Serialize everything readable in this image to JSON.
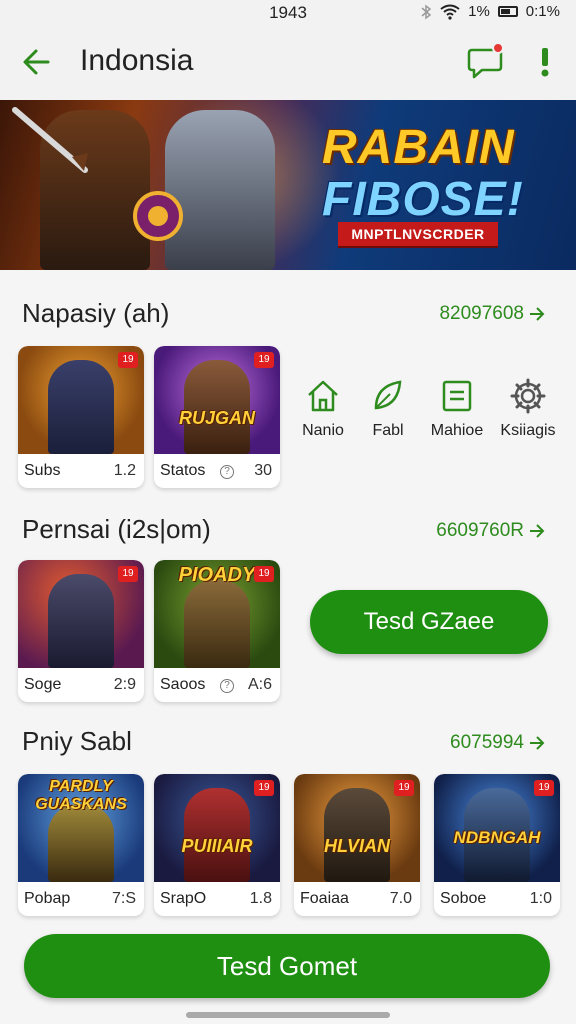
{
  "status_bar": {
    "time": "1943",
    "signal_text": "1%",
    "battery_text": "0:1%"
  },
  "app_bar": {
    "title": "Indonsia",
    "back_icon": "back-arrow-icon",
    "notification_icon": "chat-bubble-icon",
    "alert_icon": "exclamation-icon"
  },
  "banner": {
    "line1": "RABAIN",
    "line2": "FIBOSE!",
    "ribbon": "MNPTLNVSCRDER"
  },
  "sections": [
    {
      "title": "Napasiy (ah)",
      "more": "82097608",
      "cards": [
        {
          "name": "Subs",
          "rating": "1.2",
          "badge": "19",
          "art_word": ""
        },
        {
          "name": "Statos",
          "rating": "30",
          "badge": "19",
          "art_word": "RUJGAN",
          "info": "?"
        }
      ],
      "quick_actions": [
        {
          "label": "Nanio",
          "icon": "home-icon"
        },
        {
          "label": "Fabl",
          "icon": "leaf-icon"
        },
        {
          "label": "Mahioe",
          "icon": "list-icon"
        },
        {
          "label": "Ksiiagis",
          "icon": "gear-icon"
        }
      ]
    },
    {
      "title": "Pernsai (i2s|om)",
      "more": "6609760R",
      "cards": [
        {
          "name": "Soge",
          "rating": "2:9",
          "badge": "19",
          "art_word": ""
        },
        {
          "name": "Saoos",
          "rating": "A:6",
          "badge": "19",
          "art_word": "PIOADY",
          "info": "?"
        }
      ],
      "button": "Tesd GZaee"
    },
    {
      "title": "Pniy Sabl",
      "more": "6075994",
      "cards": [
        {
          "name": "Pobap",
          "rating": "7:S",
          "badge": "",
          "art_word": "PARDLY GUASKANS"
        },
        {
          "name": "SrapO",
          "rating": "1.8",
          "badge": "19",
          "art_word": "PUIIIAIR"
        },
        {
          "name": "Foaiaa",
          "rating": "7.0",
          "badge": "19",
          "art_word": "HLVIAN"
        },
        {
          "name": "Soboe",
          "rating": "1:0",
          "badge": "19",
          "art_word": "NDBNGAH"
        }
      ]
    }
  ],
  "bottom": {
    "button": "Tesd Gomet"
  },
  "colors": {
    "accent": "#1f8f12",
    "link": "#2e8b1e",
    "badge": "#e02020"
  }
}
